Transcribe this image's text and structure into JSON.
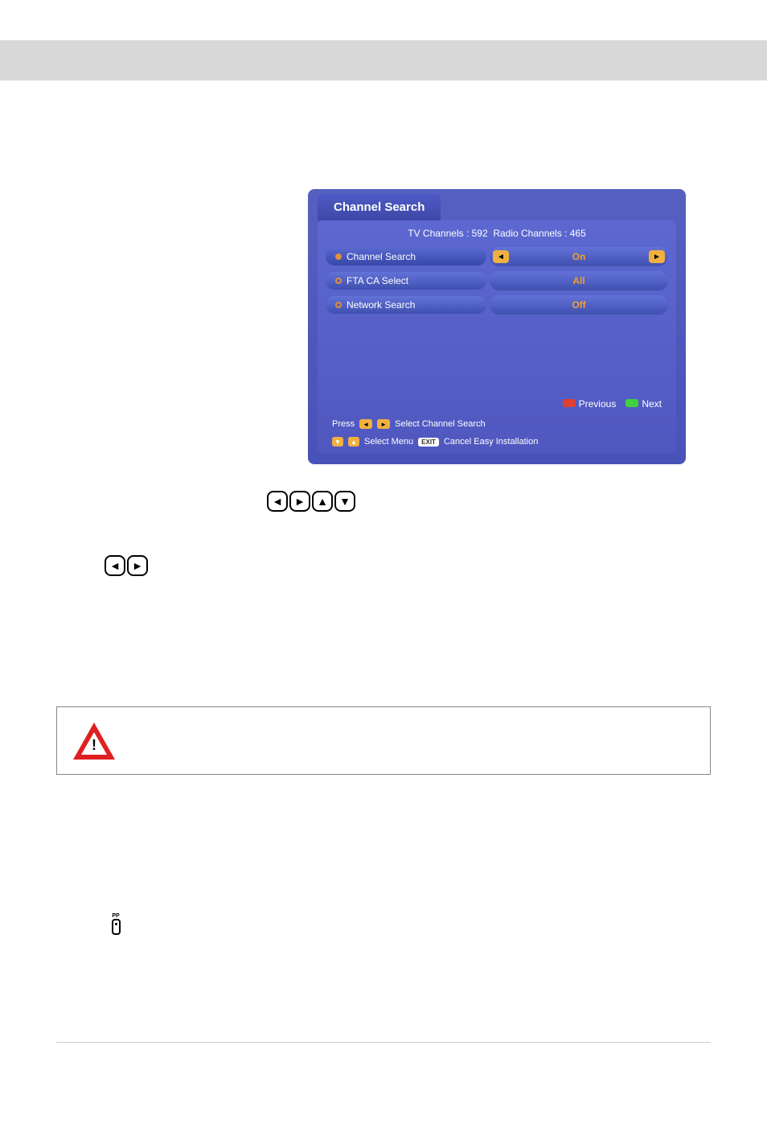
{
  "panel": {
    "title": "Channel Search",
    "tvChannels": "TV Channels : 592",
    "radioChannels": "Radio Channels : 465",
    "rows": [
      {
        "label": "Channel Search",
        "value": "On",
        "selected": true,
        "showArrows": true
      },
      {
        "label": "FTA CA Select",
        "value": "All",
        "selected": false,
        "showArrows": false
      },
      {
        "label": "Network Search",
        "value": "Off",
        "selected": false,
        "showArrows": false
      }
    ],
    "previousLabel": "Previous",
    "nextLabel": "Next",
    "hint1Prefix": "Press",
    "hint1Text": "Select Channel Search",
    "hint2Text1": "Select Menu",
    "hint2Text2": "Cancel Easy Installation",
    "exitLabel": "EXIT"
  },
  "icons": {
    "ppLabel": "PP"
  }
}
